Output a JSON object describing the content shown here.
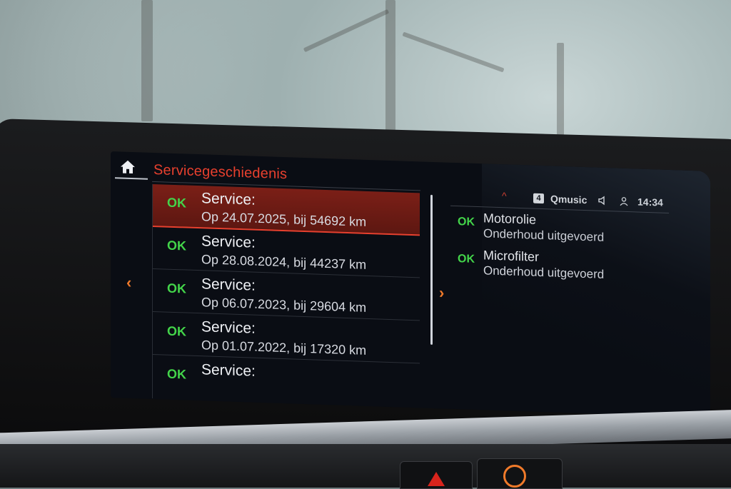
{
  "header": {
    "title": "Servicegeschiedenis",
    "home_icon": "home-icon"
  },
  "service_list": {
    "items": [
      {
        "status": "OK",
        "title": "Service:",
        "detail": "Op 24.07.2025, bij 54692 km",
        "selected": true
      },
      {
        "status": "OK",
        "title": "Service:",
        "detail": "Op 28.08.2024, bij 44237 km",
        "selected": false
      },
      {
        "status": "OK",
        "title": "Service:",
        "detail": "Op 06.07.2023, bij 29604 km",
        "selected": false
      },
      {
        "status": "OK",
        "title": "Service:",
        "detail": "Op 01.07.2022, bij 17320 km",
        "selected": false
      },
      {
        "status": "OK",
        "title": "Service:",
        "detail": "",
        "selected": false
      }
    ],
    "left_arrow": "‹",
    "right_arrow": "›"
  },
  "status_bar": {
    "caret": "^",
    "radio_preset": "4",
    "radio_station": "Qmusic",
    "speaker_icon": "speaker-icon",
    "user_icon": "user-icon",
    "time": "14:34"
  },
  "details": [
    {
      "status": "OK",
      "title": "Motorolie",
      "description": "Onderhoud uitgevoerd"
    },
    {
      "status": "OK",
      "title": "Microfilter",
      "description": "Onderhoud uitgevoerd"
    }
  ],
  "colors": {
    "accent": "#e8402e",
    "ok_green": "#43d44a",
    "arrow_orange": "#f07a2a",
    "screen_bg": "#0a0d14"
  }
}
